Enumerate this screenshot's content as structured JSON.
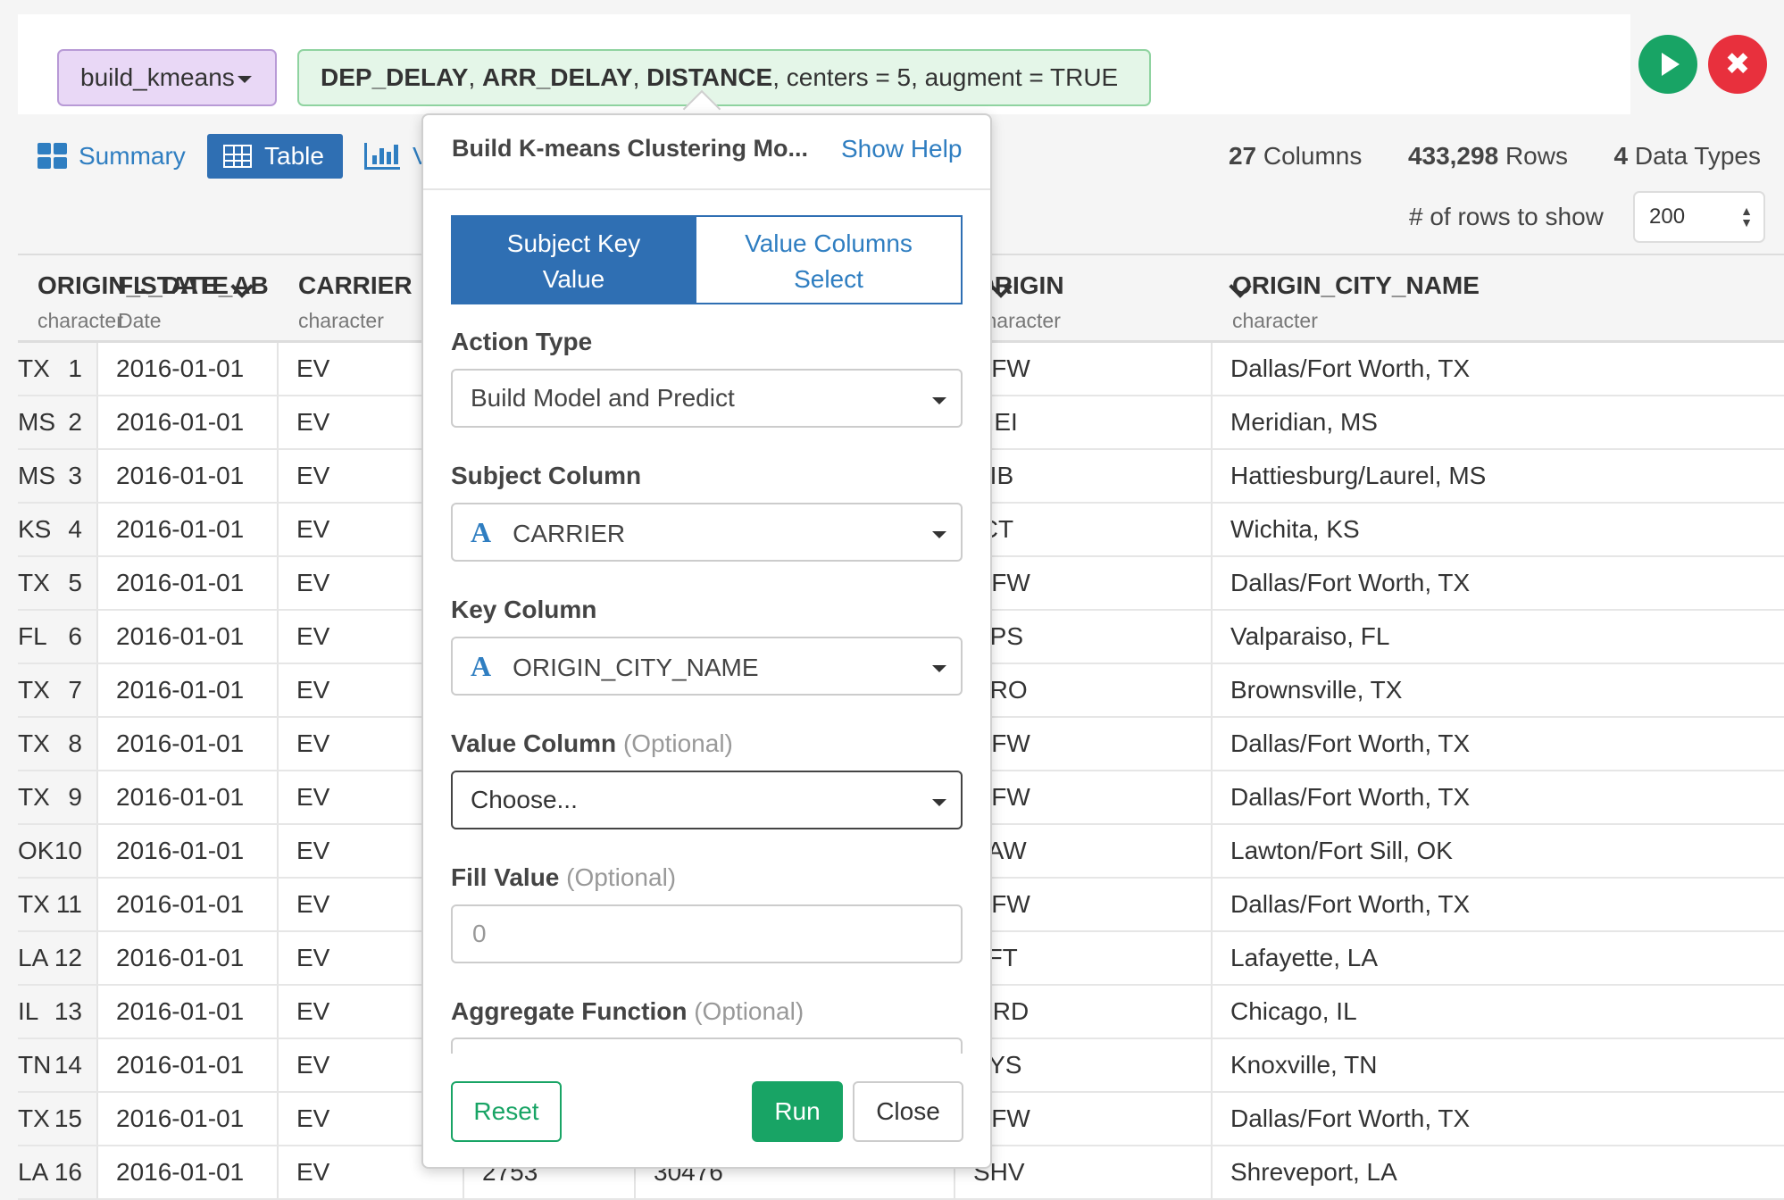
{
  "command": {
    "function_name": "build_kmeans",
    "args_bold_1": "DEP_DELAY",
    "args_sep_1": ", ",
    "args_bold_2": "ARR_DELAY",
    "args_sep_2": ", ",
    "args_bold_3": "DISTANCE",
    "args_rest": ", centers = 5, augment = TRUE",
    "cancel_glyph": "✖",
    "run_color": "#18a465",
    "cancel_color": "#e8303d"
  },
  "views": {
    "summary_label": "Summary",
    "table_label": "Table",
    "chart_label": "V",
    "active": "Table"
  },
  "stats": {
    "columns_count": "27",
    "columns_label": "Columns",
    "rows_count": "433,298",
    "rows_label": "Rows",
    "types_count": "4",
    "types_label": "Data Types",
    "rows_to_show_label": "# of rows to show",
    "rows_to_show_value": "200",
    "rows_to_show_arrows": "▲▼"
  },
  "table": {
    "columns": [
      {
        "name": "FL_DATE",
        "type": "Date"
      },
      {
        "name": "CARRIER",
        "type": "character"
      },
      {
        "name": "",
        "type": ""
      },
      {
        "name": "",
        "type": ""
      },
      {
        "name": "ORIGIN",
        "type": "character"
      },
      {
        "name": "ORIGIN_CITY_NAME",
        "type": "character"
      },
      {
        "name": "ORIGIN_STATE_AB",
        "type": "character"
      }
    ],
    "rows": [
      [
        "1",
        "2016-01-01",
        "EV",
        "",
        "",
        "DFW",
        "Dallas/Fort Worth, TX",
        "TX"
      ],
      [
        "2",
        "2016-01-01",
        "EV",
        "",
        "",
        "MEI",
        "Meridian, MS",
        "MS"
      ],
      [
        "3",
        "2016-01-01",
        "EV",
        "",
        "",
        "PIB",
        "Hattiesburg/Laurel, MS",
        "MS"
      ],
      [
        "4",
        "2016-01-01",
        "EV",
        "",
        "",
        "ICT",
        "Wichita, KS",
        "KS"
      ],
      [
        "5",
        "2016-01-01",
        "EV",
        "",
        "",
        "DFW",
        "Dallas/Fort Worth, TX",
        "TX"
      ],
      [
        "6",
        "2016-01-01",
        "EV",
        "",
        "",
        "VPS",
        "Valparaiso, FL",
        "FL"
      ],
      [
        "7",
        "2016-01-01",
        "EV",
        "",
        "",
        "BRO",
        "Brownsville, TX",
        "TX"
      ],
      [
        "8",
        "2016-01-01",
        "EV",
        "",
        "",
        "DFW",
        "Dallas/Fort Worth, TX",
        "TX"
      ],
      [
        "9",
        "2016-01-01",
        "EV",
        "",
        "",
        "DFW",
        "Dallas/Fort Worth, TX",
        "TX"
      ],
      [
        "10",
        "2016-01-01",
        "EV",
        "",
        "",
        "LAW",
        "Lawton/Fort Sill, OK",
        "OK"
      ],
      [
        "11",
        "2016-01-01",
        "EV",
        "",
        "",
        "DFW",
        "Dallas/Fort Worth, TX",
        "TX"
      ],
      [
        "12",
        "2016-01-01",
        "EV",
        "",
        "",
        "LFT",
        "Lafayette, LA",
        "LA"
      ],
      [
        "13",
        "2016-01-01",
        "EV",
        "",
        "",
        "ORD",
        "Chicago, IL",
        "IL"
      ],
      [
        "14",
        "2016-01-01",
        "EV",
        "",
        "",
        "TYS",
        "Knoxville, TN",
        "TN"
      ],
      [
        "15",
        "2016-01-01",
        "EV",
        "",
        "",
        "DFW",
        "Dallas/Fort Worth, TX",
        "TX"
      ],
      [
        "16",
        "2016-01-01",
        "EV",
        "2753",
        "30476",
        "SHV",
        "Shreveport, LA",
        "LA"
      ]
    ]
  },
  "dialog": {
    "title": "Build K-means Clustering Mo...",
    "help_link": "Show Help",
    "tab_active_line1": "Subject Key",
    "tab_active_line2": "Value",
    "tab_other_line1": "Value Columns",
    "tab_other_line2": "Select",
    "action_type_label": "Action Type",
    "action_type_value": "Build Model and Predict",
    "subject_column_label": "Subject Column",
    "subject_column_icon": "A",
    "subject_column_value": "CARRIER",
    "key_column_label": "Key Column",
    "key_column_icon": "A",
    "key_column_value": "ORIGIN_CITY_NAME",
    "value_column_label": "Value Column",
    "value_column_optional": "(Optional)",
    "value_column_value": "Choose...",
    "fill_value_label": "Fill Value",
    "fill_value_optional": "(Optional)",
    "fill_value_placeholder": "0",
    "aggregate_label": "Aggregate Function",
    "aggregate_optional": "(Optional)",
    "reset_label": "Reset",
    "run_label": "Run",
    "close_label": "Close"
  }
}
